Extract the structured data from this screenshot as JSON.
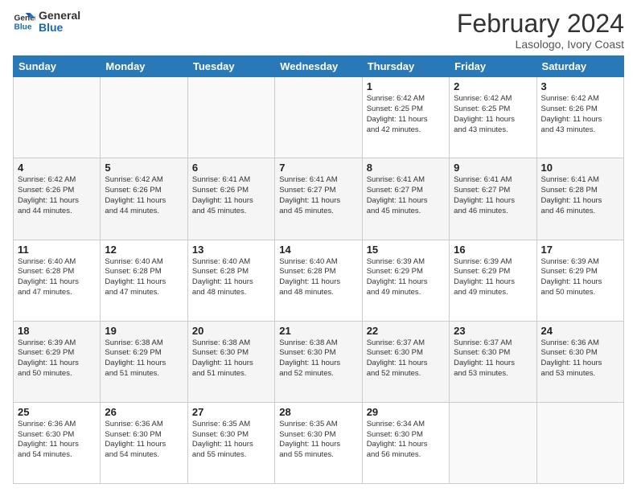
{
  "header": {
    "logo_line1": "General",
    "logo_line2": "Blue",
    "main_title": "February 2024",
    "subtitle": "Lasologo, Ivory Coast"
  },
  "days_of_week": [
    "Sunday",
    "Monday",
    "Tuesday",
    "Wednesday",
    "Thursday",
    "Friday",
    "Saturday"
  ],
  "weeks": [
    [
      {
        "num": "",
        "info": ""
      },
      {
        "num": "",
        "info": ""
      },
      {
        "num": "",
        "info": ""
      },
      {
        "num": "",
        "info": ""
      },
      {
        "num": "1",
        "info": "Sunrise: 6:42 AM\nSunset: 6:25 PM\nDaylight: 11 hours\nand 42 minutes."
      },
      {
        "num": "2",
        "info": "Sunrise: 6:42 AM\nSunset: 6:25 PM\nDaylight: 11 hours\nand 43 minutes."
      },
      {
        "num": "3",
        "info": "Sunrise: 6:42 AM\nSunset: 6:26 PM\nDaylight: 11 hours\nand 43 minutes."
      }
    ],
    [
      {
        "num": "4",
        "info": "Sunrise: 6:42 AM\nSunset: 6:26 PM\nDaylight: 11 hours\nand 44 minutes."
      },
      {
        "num": "5",
        "info": "Sunrise: 6:42 AM\nSunset: 6:26 PM\nDaylight: 11 hours\nand 44 minutes."
      },
      {
        "num": "6",
        "info": "Sunrise: 6:41 AM\nSunset: 6:26 PM\nDaylight: 11 hours\nand 45 minutes."
      },
      {
        "num": "7",
        "info": "Sunrise: 6:41 AM\nSunset: 6:27 PM\nDaylight: 11 hours\nand 45 minutes."
      },
      {
        "num": "8",
        "info": "Sunrise: 6:41 AM\nSunset: 6:27 PM\nDaylight: 11 hours\nand 45 minutes."
      },
      {
        "num": "9",
        "info": "Sunrise: 6:41 AM\nSunset: 6:27 PM\nDaylight: 11 hours\nand 46 minutes."
      },
      {
        "num": "10",
        "info": "Sunrise: 6:41 AM\nSunset: 6:28 PM\nDaylight: 11 hours\nand 46 minutes."
      }
    ],
    [
      {
        "num": "11",
        "info": "Sunrise: 6:40 AM\nSunset: 6:28 PM\nDaylight: 11 hours\nand 47 minutes."
      },
      {
        "num": "12",
        "info": "Sunrise: 6:40 AM\nSunset: 6:28 PM\nDaylight: 11 hours\nand 47 minutes."
      },
      {
        "num": "13",
        "info": "Sunrise: 6:40 AM\nSunset: 6:28 PM\nDaylight: 11 hours\nand 48 minutes."
      },
      {
        "num": "14",
        "info": "Sunrise: 6:40 AM\nSunset: 6:28 PM\nDaylight: 11 hours\nand 48 minutes."
      },
      {
        "num": "15",
        "info": "Sunrise: 6:39 AM\nSunset: 6:29 PM\nDaylight: 11 hours\nand 49 minutes."
      },
      {
        "num": "16",
        "info": "Sunrise: 6:39 AM\nSunset: 6:29 PM\nDaylight: 11 hours\nand 49 minutes."
      },
      {
        "num": "17",
        "info": "Sunrise: 6:39 AM\nSunset: 6:29 PM\nDaylight: 11 hours\nand 50 minutes."
      }
    ],
    [
      {
        "num": "18",
        "info": "Sunrise: 6:39 AM\nSunset: 6:29 PM\nDaylight: 11 hours\nand 50 minutes."
      },
      {
        "num": "19",
        "info": "Sunrise: 6:38 AM\nSunset: 6:29 PM\nDaylight: 11 hours\nand 51 minutes."
      },
      {
        "num": "20",
        "info": "Sunrise: 6:38 AM\nSunset: 6:30 PM\nDaylight: 11 hours\nand 51 minutes."
      },
      {
        "num": "21",
        "info": "Sunrise: 6:38 AM\nSunset: 6:30 PM\nDaylight: 11 hours\nand 52 minutes."
      },
      {
        "num": "22",
        "info": "Sunrise: 6:37 AM\nSunset: 6:30 PM\nDaylight: 11 hours\nand 52 minutes."
      },
      {
        "num": "23",
        "info": "Sunrise: 6:37 AM\nSunset: 6:30 PM\nDaylight: 11 hours\nand 53 minutes."
      },
      {
        "num": "24",
        "info": "Sunrise: 6:36 AM\nSunset: 6:30 PM\nDaylight: 11 hours\nand 53 minutes."
      }
    ],
    [
      {
        "num": "25",
        "info": "Sunrise: 6:36 AM\nSunset: 6:30 PM\nDaylight: 11 hours\nand 54 minutes."
      },
      {
        "num": "26",
        "info": "Sunrise: 6:36 AM\nSunset: 6:30 PM\nDaylight: 11 hours\nand 54 minutes."
      },
      {
        "num": "27",
        "info": "Sunrise: 6:35 AM\nSunset: 6:30 PM\nDaylight: 11 hours\nand 55 minutes."
      },
      {
        "num": "28",
        "info": "Sunrise: 6:35 AM\nSunset: 6:30 PM\nDaylight: 11 hours\nand 55 minutes."
      },
      {
        "num": "29",
        "info": "Sunrise: 6:34 AM\nSunset: 6:30 PM\nDaylight: 11 hours\nand 56 minutes."
      },
      {
        "num": "",
        "info": ""
      },
      {
        "num": "",
        "info": ""
      }
    ]
  ]
}
